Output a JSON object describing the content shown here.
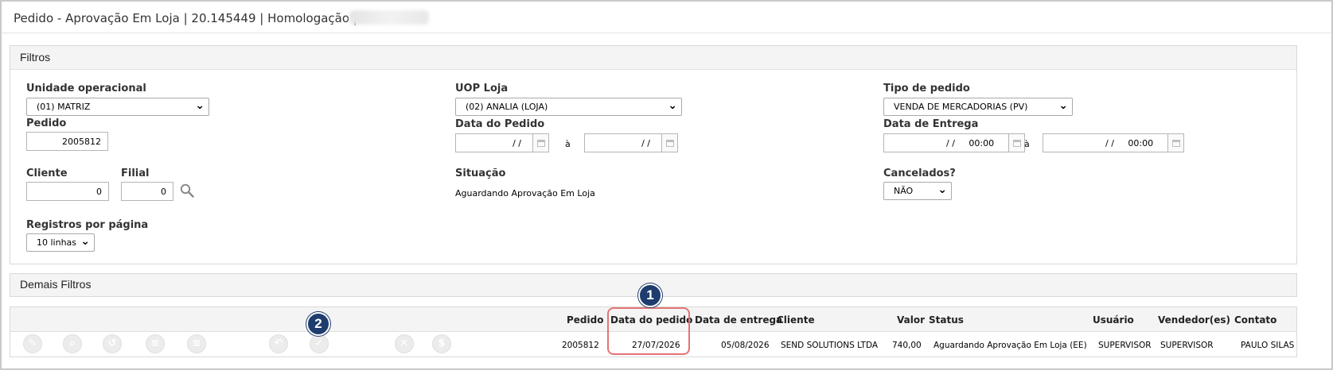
{
  "window": {
    "title": "Pedido - Aprovação Em Loja | 20.145449 | Homologação |"
  },
  "filtros": {
    "header": "Filtros",
    "unidade_operacional": {
      "label": "Unidade operacional",
      "value": "(01) MATRIZ"
    },
    "uop_loja": {
      "label": "UOP Loja",
      "value": "(02) ANALIA (LOJA)"
    },
    "tipo_pedido": {
      "label": "Tipo de pedido",
      "value": "VENDA DE MERCADORIAS (PV)"
    },
    "pedido": {
      "label": "Pedido",
      "value": "2005812"
    },
    "data_pedido": {
      "label": "Data do Pedido",
      "from": "/ /",
      "to": "/ /",
      "sep": "à"
    },
    "data_entrega": {
      "label": "Data de Entrega",
      "from": "/ /",
      "from_time": "00:00",
      "to": "/ /",
      "to_time": "00:00",
      "sep": "à"
    },
    "cliente": {
      "label": "Cliente",
      "value": "0"
    },
    "filial": {
      "label": "Filial",
      "value": "0"
    },
    "situacao": {
      "label": "Situação",
      "value": "Aguardando Aprovação Em Loja"
    },
    "cancelados": {
      "label": "Cancelados?",
      "value": "NÃO"
    },
    "registros": {
      "label": "Registros por página",
      "value": "10 linhas"
    }
  },
  "demais_filtros": {
    "header": "Demais Filtros"
  },
  "table": {
    "columns": [
      "Pedido",
      "Data do pedido",
      "Data de entrega",
      "Cliente",
      "Valor",
      "Status",
      "Usuário",
      "Vendedor(es)",
      "Contato"
    ],
    "rows": [
      {
        "pedido": "2005812",
        "data_pedido": "27/07/2026",
        "data_entrega": "05/08/2026",
        "cliente": "SEND SOLUTIONS LTDA",
        "valor": "740,00",
        "status": "Aguardando Aprovação Em Loja (EE)",
        "usuario": "SUPERVISOR",
        "vendedor": "SUPERVISOR",
        "contato": "PAULO SILAS"
      }
    ]
  },
  "annotations": {
    "badge1": "1",
    "badge2": "2"
  },
  "colors": {
    "badge": "#1f3c6e",
    "highlight": "#e57373",
    "action_icon": "#ececec"
  }
}
